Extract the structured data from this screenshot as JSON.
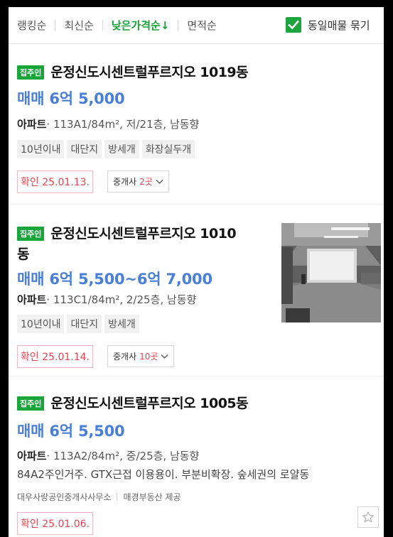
{
  "sortbar": {
    "items": [
      {
        "label": "랭킹순"
      },
      {
        "label": "최신순"
      },
      {
        "label": "낮은가격순↓"
      },
      {
        "label": "면적순"
      }
    ],
    "group_toggle_label": "동일매물 묶기",
    "group_toggle_checked": true
  },
  "colors": {
    "accent_green": "#1aa23a",
    "price_blue": "#4a7fd8",
    "confirm_red": "#e9434f"
  },
  "listings": [
    {
      "badge": "집주인",
      "title": "운정신도시센트럴푸르지오 1019동",
      "price": "매매 6억 5,000",
      "spec_type": "아파트",
      "spec_detail": "· 113A1/84m², 저/21층, 남동향",
      "tags": [
        "10년이내",
        "대단지",
        "방세개",
        "화장실두개"
      ],
      "confirm": "확인 25.01.13.",
      "agent_label": "중개사",
      "agent_count": "2곳"
    },
    {
      "badge": "집주인",
      "title_line1": "운정신도시센트럴푸르지오 1010",
      "title_line2": "동",
      "price": "매매 6억 5,500~6억 7,000",
      "spec_type": "아파트",
      "spec_detail": "· 113C1/84m², 2/25층, 남동향",
      "tags": [
        "10년이내",
        "대단지",
        "방세개"
      ],
      "confirm": "확인 25.01.14.",
      "agent_label": "중개사",
      "agent_count": "10곳",
      "photo_icon": "apartment-interior-photo"
    },
    {
      "badge": "집주인",
      "title": "운정신도시센트럴푸르지오 1005동",
      "price": "매매 6억 5,500",
      "spec_type": "아파트",
      "spec_detail": "· 113A2/84m², 중/25층, 남동향",
      "description": "84A2주인거주. GTX근접 이용용이. 부분비확장. 숲세권의 로얄동",
      "source_agent": "대우사랑공인중개사사무소",
      "source_provider": "매경부동산 제공",
      "confirm": "확인 25.01.06.",
      "favorite_icon": "star-icon"
    }
  ]
}
